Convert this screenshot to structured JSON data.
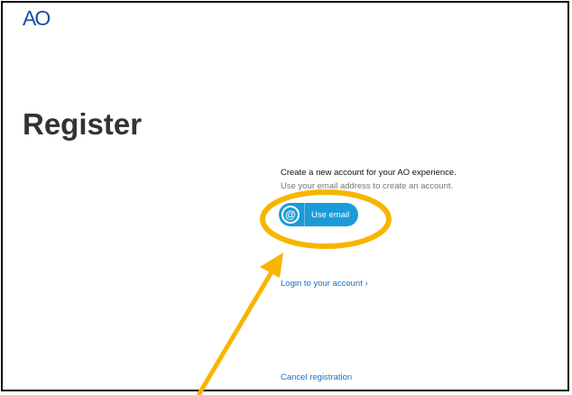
{
  "app": {
    "logo_text": "AO"
  },
  "page": {
    "title": "Register",
    "headline": "Create a new account for your AO experience.",
    "subline": "Use your email address to create an account."
  },
  "actions": {
    "email_button": {
      "icon": "at-sign-icon",
      "icon_glyph": "@",
      "label": "Use email"
    },
    "login_link": "Login to your account ›",
    "cancel_link": "Cancel registration"
  },
  "annotation": {
    "highlight": "ellipse-highlight",
    "pointer": "arrow-pointer"
  },
  "colors": {
    "brand_blue": "#1a4ea3",
    "button_blue": "#1b9bd7",
    "link_blue": "#1b6fc2",
    "annotation_gold": "#f7b500",
    "title_text": "#333333"
  }
}
